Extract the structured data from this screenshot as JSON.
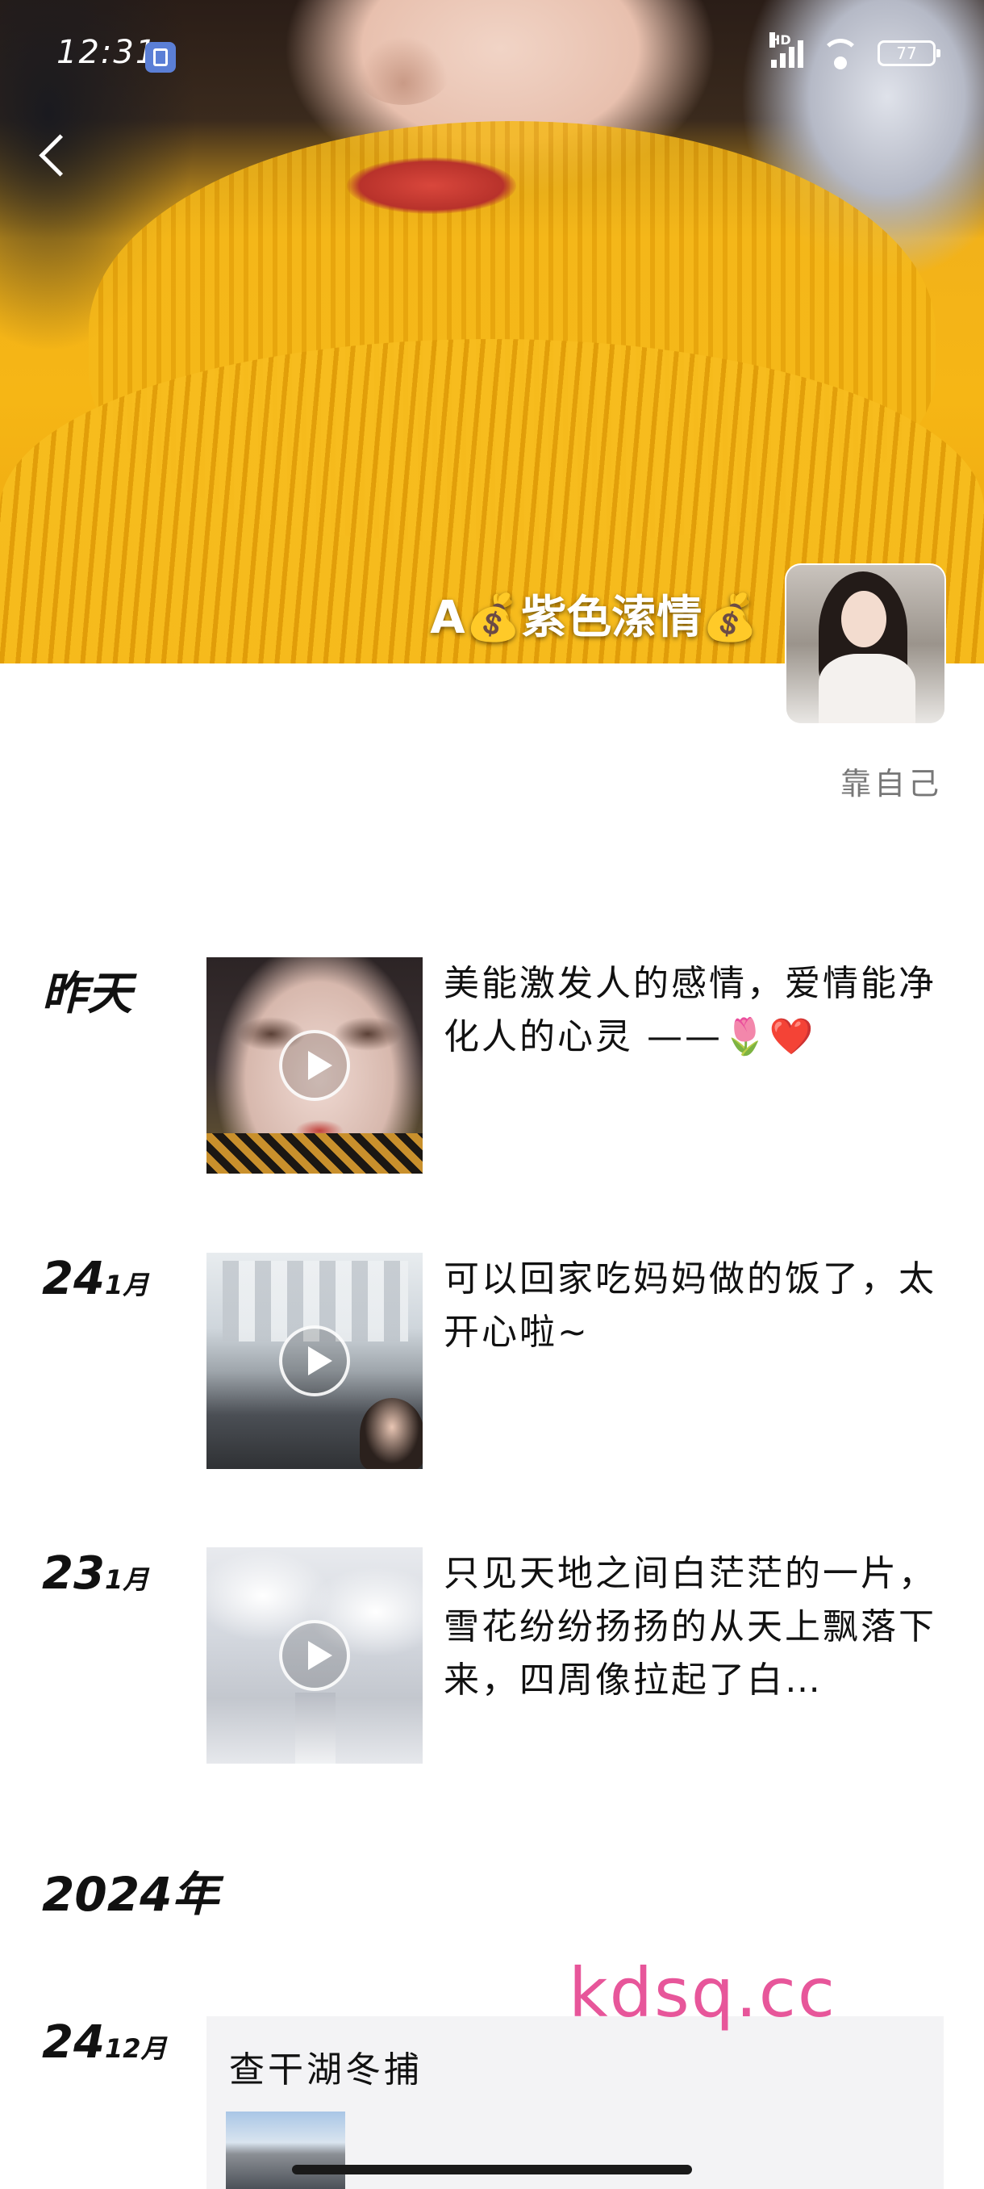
{
  "status_bar": {
    "time": "12:31",
    "network_label": "HD",
    "battery_level": "77"
  },
  "profile": {
    "nickname": "A💰紫色溹情💰",
    "signature": "靠自己"
  },
  "posts": [
    {
      "date": "昨天",
      "day": "",
      "month": "",
      "text": "美能激发人的感情，爱情能净化人的心灵 ——🌷❤️",
      "media": "video"
    },
    {
      "date": "",
      "day": "24",
      "month": "1月",
      "text": "可以回家吃妈妈做的饭了，太开心啦~",
      "media": "video"
    },
    {
      "date": "",
      "day": "23",
      "month": "1月",
      "text": "只见天地之间白茫茫的一片，雪花纷纷扬扬的从天上飘落下来，四周像拉起了白…",
      "media": "video"
    }
  ],
  "year_heading": "2024年",
  "article_post": {
    "day": "24",
    "month": "12月",
    "title": "查干湖冬捕"
  },
  "watermark": "kdsq.cc",
  "icons": {
    "back": "chevron-left-icon",
    "play": "play-icon",
    "wifi": "wifi-icon",
    "signal": "signal-icon",
    "battery": "battery-icon"
  }
}
